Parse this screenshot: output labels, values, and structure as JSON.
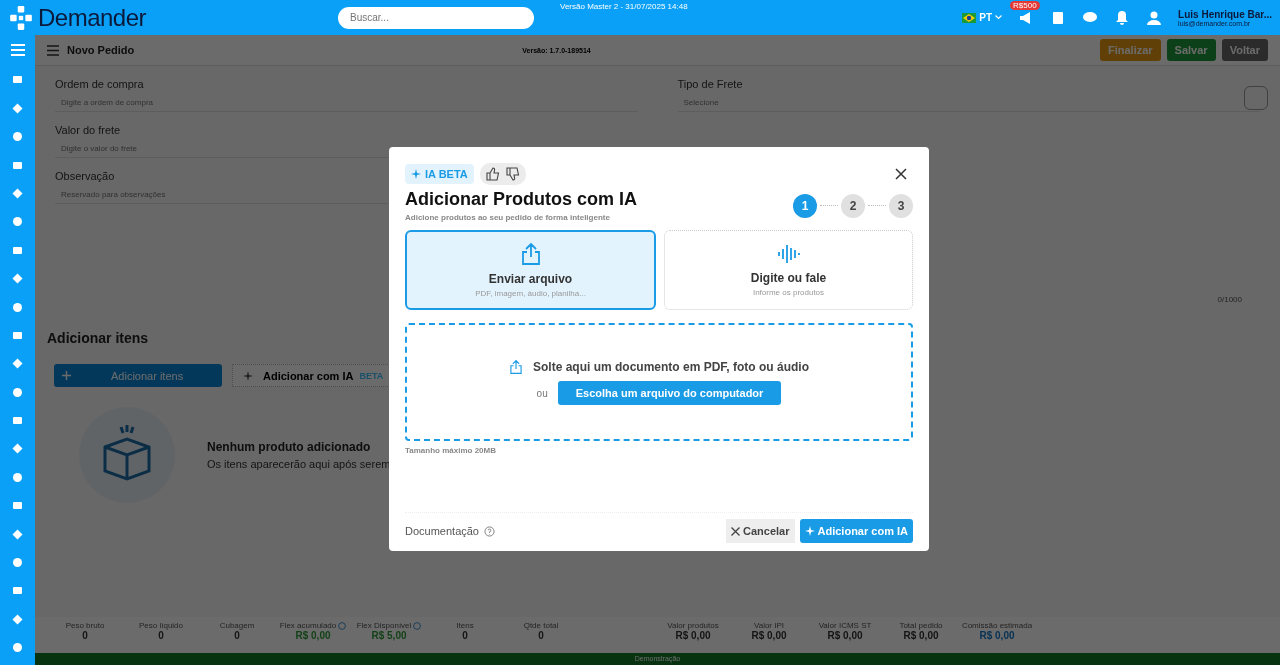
{
  "header": {
    "brand": "Demander",
    "search": {
      "placeholder": "Buscar..."
    },
    "build_info": "Versão Master 2 - 31/07/2025 14:48",
    "language": "PT",
    "notice_badge": "R$500",
    "user": {
      "name": "Luis Henrique Bar...",
      "email": "luis@demander.com.br"
    }
  },
  "page": {
    "title": "Novo Pedido",
    "version": "Versão: 1.7.0-189514",
    "actions": [
      {
        "label": "Finalizar",
        "kind": "finish"
      },
      {
        "label": "Salvar",
        "kind": "save"
      },
      {
        "label": "Voltar",
        "kind": "back"
      }
    ]
  },
  "form": {
    "left": [
      {
        "label": "Ordem de compra",
        "placeholder": "Digite a ordem de compra"
      },
      {
        "label": "Valor do frete",
        "placeholder": "Digite o valor do frete"
      },
      {
        "label": "Observação",
        "placeholder": "Reservado para observações"
      }
    ],
    "right": [
      {
        "label": "Tipo de Frete",
        "placeholder": "Selecione"
      }
    ],
    "counter": "0/1000"
  },
  "items": {
    "title": "Adicionar itens",
    "add_button": "Adicionar itens",
    "ai_button": "Adicionar com IA",
    "ai_tag": "BETA",
    "empty_title": "Nenhum produto adicionado",
    "empty_text": "Os itens aparecerão aqui após serem"
  },
  "summary": [
    {
      "label": "Peso bruto",
      "value": "0",
      "help": false,
      "kind": "plain"
    },
    {
      "label": "Peso líquido",
      "value": "0",
      "help": false,
      "kind": "plain"
    },
    {
      "label": "Cubagem",
      "value": "0",
      "help": false,
      "kind": "plain"
    },
    {
      "label": "Flex acumulado",
      "value": "R$ 0,00",
      "help": true,
      "kind": "flex"
    },
    {
      "label": "Flex Disponível",
      "value": "R$ 5,00",
      "help": true,
      "kind": "flex"
    },
    {
      "label": "Itens",
      "value": "0",
      "help": false,
      "kind": "plain"
    },
    {
      "label": "Qtde total",
      "value": "0",
      "help": false,
      "kind": "plain"
    },
    {
      "label": "Valor produtos",
      "value": "R$ 0,00",
      "help": false,
      "kind": "plain"
    },
    {
      "label": "Valor IPI",
      "value": "R$ 0,00",
      "help": false,
      "kind": "plain"
    },
    {
      "label": "Valor ICMS ST",
      "value": "R$ 0,00",
      "help": false,
      "kind": "plain"
    },
    {
      "label": "Total pedido",
      "value": "R$ 0,00",
      "help": false,
      "kind": "plain"
    },
    {
      "label": "Comissão estimada",
      "value": "R$ 0,00",
      "help": false,
      "kind": "commission"
    }
  ],
  "footer_banner": "Demonstração",
  "modal": {
    "badge": "IA BETA",
    "title": "Adicionar Produtos com IA",
    "subtitle": "Adicione produtos ao seu pedido de forma inteligente",
    "steps": [
      {
        "number": "1",
        "selected": true
      },
      {
        "number": "2",
        "selected": false
      },
      {
        "number": "3",
        "selected": false
      }
    ],
    "options": [
      {
        "kind": "upload",
        "title": "Enviar arquivo",
        "hint": "PDF, imagem, áudio, planilha...",
        "selected": true
      },
      {
        "kind": "voice",
        "title": "Digite ou fale",
        "hint": "Informe os produtos",
        "selected": false
      }
    ],
    "dropzone": {
      "text": "Solte aqui um documento em PDF, foto ou áudio",
      "or": "ou",
      "button": "Escolha um arquivo do computador"
    },
    "max_size": "Tamanho máximo 20MB",
    "docs_link": "Documentação",
    "cancel": "Cancelar",
    "submit": "Adicionar com IA"
  }
}
